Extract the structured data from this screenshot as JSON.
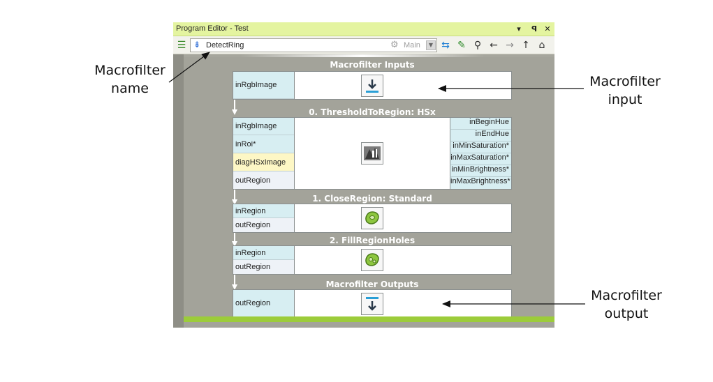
{
  "window": {
    "title": "Program Editor - Test",
    "controls": {
      "dropdown": "▾",
      "pin": "ꟼ",
      "close": "✕"
    }
  },
  "toolbar": {
    "macrofilter_name": "DetectRing",
    "worker_task": "Main"
  },
  "blocks": {
    "inputs": {
      "title": "Macrofilter Inputs",
      "ports": [
        "inRgbImage"
      ]
    },
    "threshold": {
      "title": "0. ThresholdToRegion: HSx",
      "left_ports": [
        "inRgbImage",
        "inRoi*",
        "diagHSxImage",
        "outRegion"
      ],
      "right_ports": [
        "inBeginHue",
        "inEndHue",
        "inMinSaturation*",
        "inMaxSaturation*",
        "inMinBrightness*",
        "inMaxBrightness*"
      ]
    },
    "close": {
      "title": "1. CloseRegion: Standard",
      "ports": [
        "inRegion",
        "outRegion"
      ]
    },
    "fill": {
      "title": "2. FillRegionHoles",
      "ports": [
        "inRegion",
        "outRegion"
      ]
    },
    "outputs": {
      "title": "Macrofilter Outputs",
      "ports": [
        "outRegion"
      ]
    }
  },
  "annotations": {
    "name": [
      "Macrofilter",
      "name"
    ],
    "input": [
      "Macrofilter",
      "input"
    ],
    "output": [
      "Macrofilter",
      "output"
    ]
  },
  "colors": {
    "titlebar": "#e4f4a0",
    "canvas": "#a3a39a",
    "accent_green": "#9ccc3a",
    "input_port": "#d7eef2",
    "diag_port": "#fdf7c5",
    "region_icon": "#8dc63f",
    "io_arrow_blue": "#2a9fd6"
  }
}
